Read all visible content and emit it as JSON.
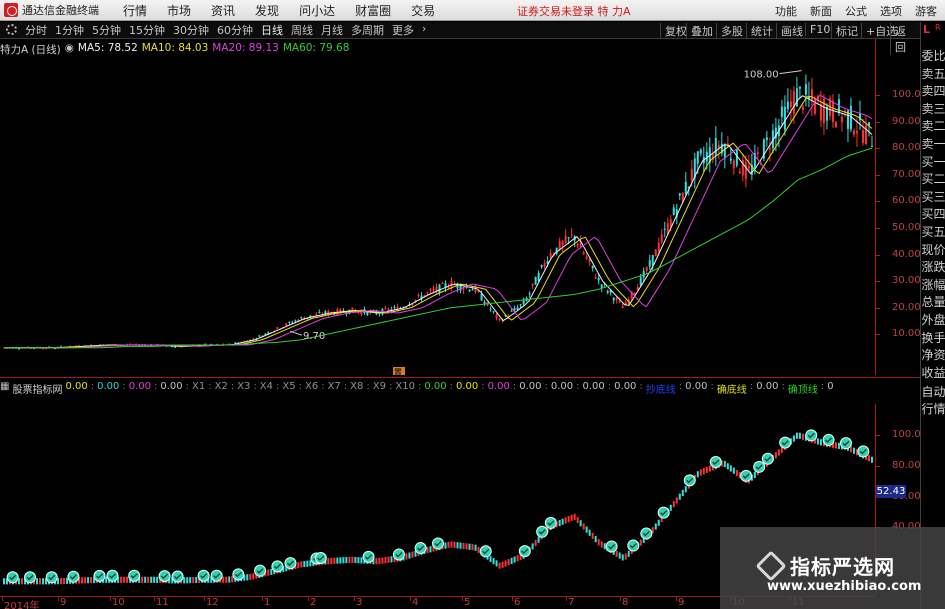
{
  "app": {
    "name": "通达信金融终端",
    "status": "证券交易未登录  特 力A"
  },
  "menu": [
    "行情",
    "市场",
    "资讯",
    "发现",
    "问小达",
    "财富圈",
    "交易"
  ],
  "menu_right": [
    "功能",
    "新面",
    "公式",
    "选项",
    "游客"
  ],
  "periods": [
    "分时",
    "1分钟",
    "5分钟",
    "15分钟",
    "30分钟",
    "60分钟",
    "日线",
    "周线",
    "月线",
    "多周期",
    "更多"
  ],
  "active_period": "日线",
  "tools": [
    "复权",
    "叠加",
    "多股",
    "统计",
    "画线",
    "F10",
    "标记",
    "+自选",
    "返回"
  ],
  "main": {
    "title": "特力A (日线)",
    "ma": [
      {
        "label": "MA5: 78.52",
        "color": "#f0f0f0"
      },
      {
        "label": "MA10: 84.03",
        "color": "#e8e020"
      },
      {
        "label": "MA20: 89.13",
        "color": "#e040e0"
      },
      {
        "label": "MA60: 79.68",
        "color": "#30d030"
      }
    ],
    "high_label": "108.00",
    "low_label": "9.70",
    "event_badge": "置"
  },
  "indicator": {
    "title": "股票指标网",
    "items": [
      {
        "text": "0.00",
        "color": "#e0e020"
      },
      {
        "text": "0.00",
        "color": "#30d0d0"
      },
      {
        "text": "0.00",
        "color": "#e040e0"
      },
      {
        "text": "0.00",
        "color": "#c0c0c0"
      },
      {
        "text": "X1",
        "color": "#909090"
      },
      {
        "text": "X2",
        "color": "#909090"
      },
      {
        "text": "X3",
        "color": "#909090"
      },
      {
        "text": "X4",
        "color": "#909090"
      },
      {
        "text": "X5",
        "color": "#909090"
      },
      {
        "text": "X6",
        "color": "#909090"
      },
      {
        "text": "X7",
        "color": "#909090"
      },
      {
        "text": "X8",
        "color": "#909090"
      },
      {
        "text": "X9",
        "color": "#909090"
      },
      {
        "text": "X10",
        "color": "#909090"
      },
      {
        "text": "0.00",
        "color": "#30d030"
      },
      {
        "text": "0.00",
        "color": "#e0e020"
      },
      {
        "text": "0.00",
        "color": "#e040e0"
      },
      {
        "text": "0.00",
        "color": "#c0c0c0"
      },
      {
        "text": "0.00",
        "color": "#c0c0c0"
      },
      {
        "text": "0.00",
        "color": "#c0c0c0"
      },
      {
        "text": "0.00",
        "color": "#c0c0c0"
      },
      {
        "text": "抄底线",
        "color": "#2040ff"
      },
      {
        "text": "0.00",
        "color": "#c0c0c0"
      },
      {
        "text": "确底线",
        "color": "#e0e020"
      },
      {
        "text": "0.00",
        "color": "#c0c0c0"
      },
      {
        "text": "确顶线",
        "color": "#30d030"
      },
      {
        "text": "0",
        "color": "#c0c0c0"
      }
    ],
    "current_value": "52.43"
  },
  "side_panel": {
    "items": [
      "委比",
      "卖五",
      "卖四",
      "卖三",
      "卖二",
      "卖一",
      "买一",
      "买二",
      "买三",
      "买四",
      "买五",
      "现价",
      "涨跌",
      "涨幅",
      "总量",
      "外盘",
      "换手",
      "净资",
      "收益"
    ],
    "auto_items": [
      "自动",
      "行情"
    ],
    "L": "L",
    "R": "R"
  },
  "axis_main": [
    "100.00",
    "90.00",
    "80.00",
    "70.00",
    "60.00",
    "50.00",
    "40.00",
    "30.00",
    "20.00",
    "10.00"
  ],
  "axis_ind": [
    "100.00",
    "80.00",
    "60.00",
    "40.00"
  ],
  "dates": [
    "2014年",
    "9",
    "10",
    "11",
    "12",
    "1",
    "2",
    "3",
    "4",
    "5",
    "6",
    "7",
    "8",
    "9",
    "10",
    "11"
  ],
  "watermark": {
    "title": "指标严选网",
    "url": "www.xuezhibiao.com"
  },
  "chart_data": {
    "type": "line",
    "title": "特力A (日线)",
    "ylim": [
      0,
      115
    ],
    "yticks": [
      10,
      20,
      30,
      40,
      50,
      60,
      70,
      80,
      90,
      100
    ],
    "price_high": 108.0,
    "price_low": 9.7,
    "x": [
      "2014年",
      "9",
      "10",
      "11",
      "12",
      "1",
      "2",
      "3",
      "4",
      "5",
      "6",
      "7",
      "8",
      "9",
      "10",
      "11"
    ],
    "series": [
      {
        "name": "price",
        "values": [
          5,
          5,
          5,
          5.5,
          6,
          6,
          6,
          5.5,
          6,
          6,
          8,
          12,
          16,
          18,
          19,
          18,
          20,
          25,
          29,
          27,
          15,
          22,
          40,
          47,
          30,
          20,
          35,
          55,
          75,
          82,
          70,
          85,
          100,
          95,
          92,
          84
        ]
      },
      {
        "name": "MA60",
        "values": [
          5,
          5,
          5,
          5,
          5,
          5.5,
          5.5,
          6,
          6,
          6,
          6.5,
          7,
          8,
          10,
          12,
          14,
          16,
          18,
          20,
          21,
          22,
          23,
          24,
          25,
          27,
          30,
          33,
          38,
          43,
          48,
          53,
          60,
          68,
          72,
          77,
          80
        ]
      }
    ],
    "indicator_ylim": [
      0,
      115
    ],
    "indicator_yticks": [
      40,
      60,
      80,
      100
    ]
  }
}
